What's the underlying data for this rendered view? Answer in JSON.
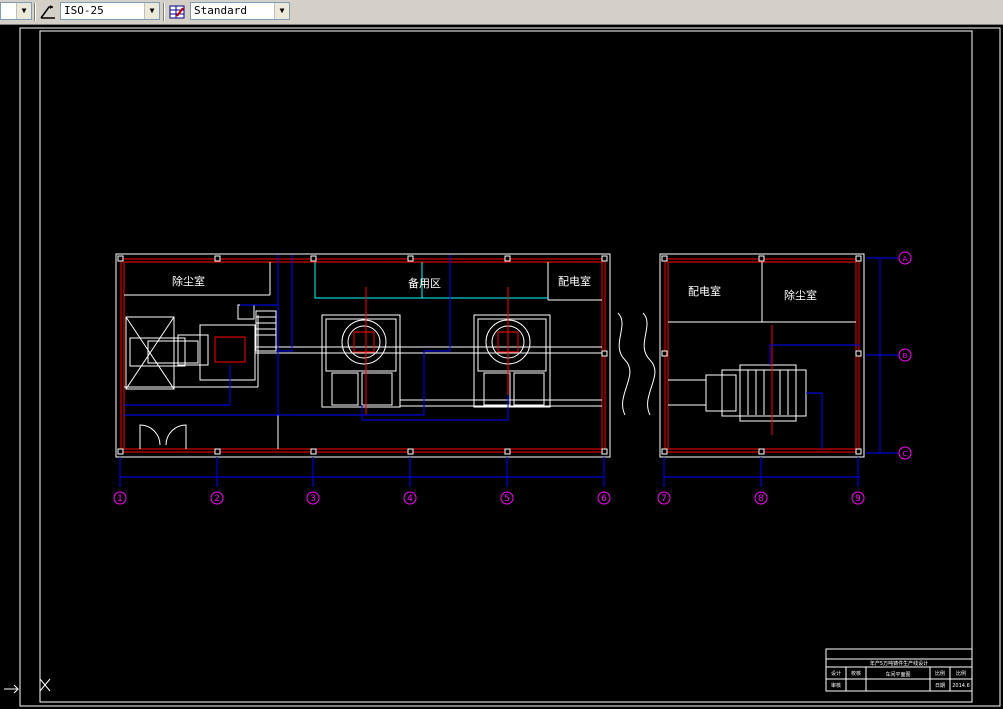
{
  "toolbar": {
    "dimstyle_value": "ISO-25",
    "tablestyle_value": "Standard",
    "dimstyle_icon": "dimension-style-icon",
    "tablestyle_icon": "table-style-icon"
  },
  "drawing": {
    "room_dust_left": "除尘室",
    "room_spare": "备用区",
    "room_power_left": "配电室",
    "room_power_right": "配电室",
    "room_dust_right": "除尘室",
    "axis_labels": [
      "1",
      "2",
      "3",
      "4",
      "5",
      "6",
      "7",
      "8",
      "9"
    ],
    "row_labels": [
      "A",
      "B",
      "C"
    ]
  },
  "title_block": {
    "project": "年产5万吨铸件生产线设计",
    "drawing_name": "车间平面图",
    "date": "2014.6",
    "sheet": "共",
    "field_designer": "设计",
    "field_checker": "校核",
    "field_approver": "审核",
    "field_scale": "比例",
    "field_ratio": "比例",
    "field_date": "日期"
  },
  "colors": {
    "background": "#000000",
    "wall": "#ff0000",
    "line": "#ffffff",
    "dimension": "#0000ff",
    "axis_bubble": "#ff00ff",
    "pipe": "#00ffff",
    "toolbar": "#d4d0c8"
  }
}
